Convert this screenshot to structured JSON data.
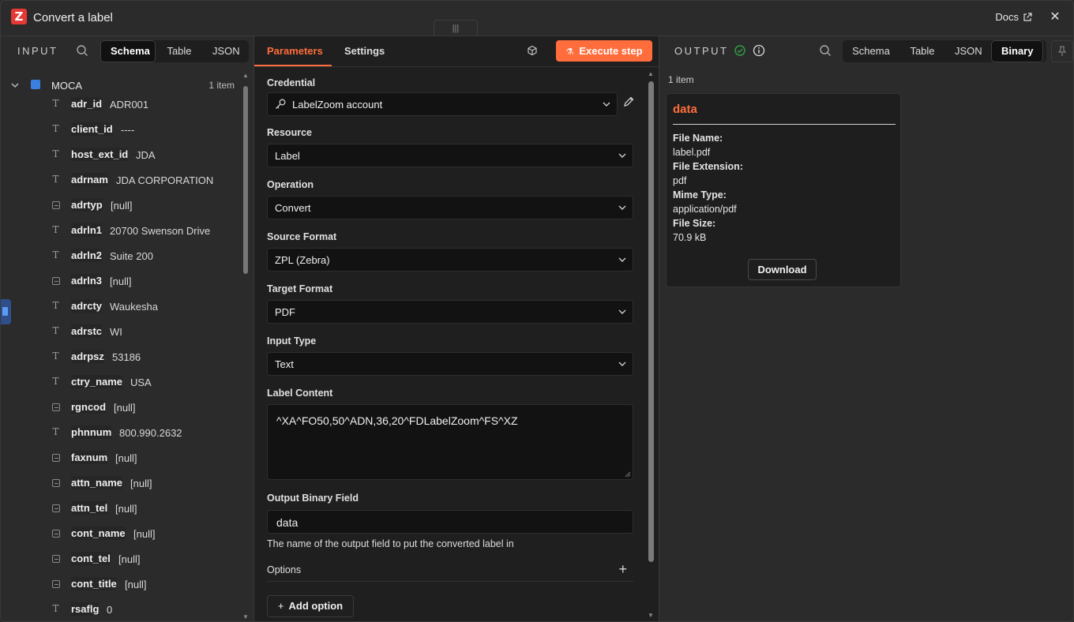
{
  "window": {
    "title": "Convert a label",
    "docs_label": "Docs",
    "close_symbol": "✕",
    "drag_handle_symbol": "|||"
  },
  "input": {
    "label": "INPUT",
    "tabs": [
      "Schema",
      "Table",
      "JSON"
    ],
    "active_tab": "Schema",
    "root": {
      "name": "MOCA",
      "count": "1 item"
    },
    "fields": [
      {
        "key": "adr_id",
        "value": "ADR001",
        "type": "text"
      },
      {
        "key": "client_id",
        "value": "----",
        "type": "text"
      },
      {
        "key": "host_ext_id",
        "value": "JDA",
        "type": "text"
      },
      {
        "key": "adrnam",
        "value": "JDA CORPORATION",
        "type": "text"
      },
      {
        "key": "adrtyp",
        "value": "[null]",
        "type": "null"
      },
      {
        "key": "adrln1",
        "value": "20700 Swenson Drive",
        "type": "text"
      },
      {
        "key": "adrln2",
        "value": "Suite 200",
        "type": "text"
      },
      {
        "key": "adrln3",
        "value": "[null]",
        "type": "null"
      },
      {
        "key": "adrcty",
        "value": "Waukesha",
        "type": "text"
      },
      {
        "key": "adrstc",
        "value": "WI",
        "type": "text"
      },
      {
        "key": "adrpsz",
        "value": "53186",
        "type": "text"
      },
      {
        "key": "ctry_name",
        "value": "USA",
        "type": "text"
      },
      {
        "key": "rgncod",
        "value": "[null]",
        "type": "null"
      },
      {
        "key": "phnnum",
        "value": "800.990.2632",
        "type": "text"
      },
      {
        "key": "faxnum",
        "value": "[null]",
        "type": "null"
      },
      {
        "key": "attn_name",
        "value": "[null]",
        "type": "null"
      },
      {
        "key": "attn_tel",
        "value": "[null]",
        "type": "null"
      },
      {
        "key": "cont_name",
        "value": "[null]",
        "type": "null"
      },
      {
        "key": "cont_tel",
        "value": "[null]",
        "type": "null"
      },
      {
        "key": "cont_title",
        "value": "[null]",
        "type": "null"
      },
      {
        "key": "rsaflg",
        "value": "0",
        "type": "text"
      }
    ]
  },
  "params": {
    "tabs": [
      "Parameters",
      "Settings"
    ],
    "active_tab": "Parameters",
    "execute_label": "Execute step",
    "credential": {
      "label": "Credential",
      "value": "LabelZoom account"
    },
    "resource": {
      "label": "Resource",
      "value": "Label"
    },
    "operation": {
      "label": "Operation",
      "value": "Convert"
    },
    "source_format": {
      "label": "Source Format",
      "value": "ZPL (Zebra)"
    },
    "target_format": {
      "label": "Target Format",
      "value": "PDF"
    },
    "input_type": {
      "label": "Input Type",
      "value": "Text"
    },
    "label_content": {
      "label": "Label Content",
      "value": "^XA^FO50,50^ADN,36,20^FDLabelZoom^FS^XZ"
    },
    "output_binary_field": {
      "label": "Output Binary Field",
      "value": "data",
      "hint": "The name of the output field to put the converted label in"
    },
    "options": {
      "label": "Options",
      "add_label": "Add option"
    }
  },
  "output": {
    "label": "OUTPUT",
    "tabs": [
      "Schema",
      "Table",
      "JSON",
      "Binary"
    ],
    "active_tab": "Binary",
    "count": "1 item",
    "binary": {
      "title": "data",
      "file_name_label": "File Name:",
      "file_name": "label.pdf",
      "file_ext_label": "File Extension:",
      "file_ext": "pdf",
      "mime_label": "Mime Type:",
      "mime": "application/pdf",
      "size_label": "File Size:",
      "size": "70.9 kB",
      "download_label": "Download"
    }
  },
  "colors": {
    "accent": "#ff6d3c",
    "success": "#2ea043",
    "object_icon": "#3b7fe0"
  }
}
